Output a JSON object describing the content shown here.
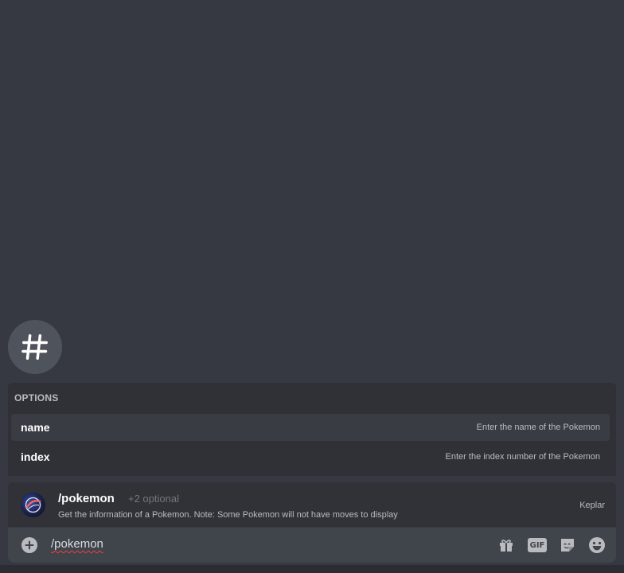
{
  "channel": {
    "icon": "hashtag-icon"
  },
  "options": {
    "header": "OPTIONS",
    "items": [
      {
        "name": "name",
        "description": "Enter the name of the Pokemon"
      },
      {
        "name": "index",
        "description": "Enter the index number of the Pokemon"
      }
    ]
  },
  "command": {
    "name": "/pokemon",
    "optional": "+2 optional",
    "description": "Get the information of a Pokemon. Note: Some Pokemon will not have moves to display",
    "app": "Keplar"
  },
  "input": {
    "value": "/pokemon",
    "icons": [
      "add-icon",
      "gift-icon",
      "gif-icon",
      "sticker-icon",
      "emoji-icon"
    ],
    "gif_label": "GIF"
  },
  "colors": {
    "background": "#363942",
    "panel": "#2f3137",
    "input": "#40444b",
    "text": "#dcddde"
  }
}
